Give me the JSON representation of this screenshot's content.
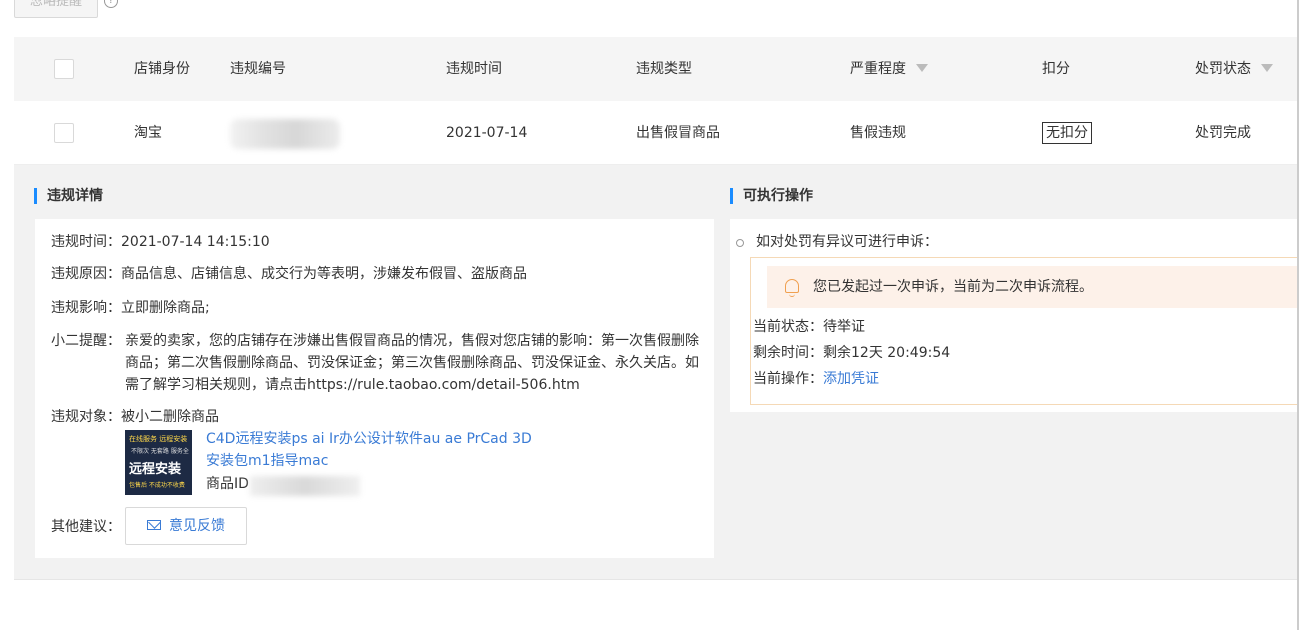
{
  "top": {
    "button_label": "忽略提醒",
    "help": "?"
  },
  "table": {
    "headers": [
      "店铺身份",
      "违规编号",
      "违规时间",
      "违规类型",
      "严重程度",
      "扣分",
      "处罚状态"
    ],
    "row": {
      "shop_identity": "淘宝",
      "violation_time": "2021-07-14",
      "violation_type": "出售假冒商品",
      "severity": "售假违规",
      "deduction": "无扣分",
      "status": "处罚完成"
    }
  },
  "detail": {
    "title": "违规详情",
    "time_label": "违规时间：",
    "time_value": "2021-07-14 14:15:10",
    "reason_label": "违规原因：",
    "reason_value": "商品信息、店铺信息、成交行为等表明，涉嫌发布假冒、盗版商品",
    "impact_label": "违规影响：",
    "impact_value": "立即删除商品;",
    "reminder_label": "小二提醒：",
    "reminder_value": "亲爱的卖家，您的店铺存在涉嫌出售假冒商品的情况，售假对您店铺的影响：第一次售假删除商品；第二次售假删除商品、罚没保证金；第三次售假删除商品、罚没保证金、永久关店。如需了解学习相关规则，请点击https://rule.taobao.com/detail-506.htm",
    "target_label": "违规对象：",
    "target_value": "被小二删除商品",
    "product": {
      "title_line1": "C4D远程安装ps ai Ir办公设计软件au ae PrCad 3D",
      "title_line2": "安装包m1指导mac",
      "id_label": "商品ID",
      "image_text_top": "在线服务 远程安装",
      "image_text_mid": "不限次 无套路 服务全",
      "image_text_main": "远程安装",
      "image_text_bottom": "包售后 不成功不收费"
    },
    "advice_label": "其他建议：",
    "feedback_label": "意见反馈"
  },
  "actions": {
    "title": "可执行操作",
    "appeal_hint": "如对处罚有异议可进行申诉：",
    "notice": "您已发起过一次申诉，当前为二次申诉流程。",
    "state_label": "当前状态：",
    "state_value": "待举证",
    "remain_label": "剩余时间：",
    "remain_value": "剩余12天 20:49:54",
    "op_label": "当前操作：",
    "op_value": "添加凭证"
  },
  "colors": {
    "accent": "#1a8cff",
    "link": "#3a7bd5",
    "notice_bg": "#fdf1e9",
    "notice_border": "#f5d9b6"
  }
}
